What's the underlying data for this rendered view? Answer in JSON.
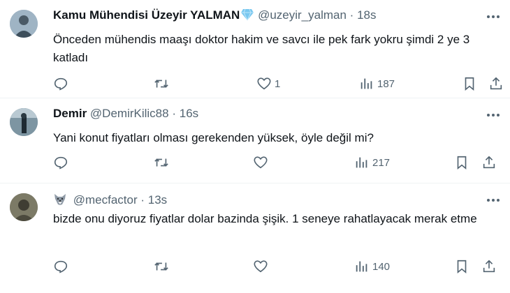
{
  "tweets": [
    {
      "name": "Kamu Mühendisi Üzeyir YALMAN",
      "handle": "@uzeyir_yalman",
      "time": "18s",
      "text": "Önceden mühendis maaşı doktor hakim ve savcı ile pek fark yokru şimdi 2 ye 3 katladı",
      "likes": "1",
      "views": "187",
      "avatar_color": "#8aa3b8"
    },
    {
      "name": "Demir",
      "handle": "@DemirKilic88",
      "time": "16s",
      "text": "Yani konut fiyatları olması gerekenden yüksek, öyle değil mi?",
      "likes": "",
      "views": "217",
      "avatar_color": "#5d7a8c"
    },
    {
      "name": "",
      "handle": "@mecfactor",
      "time": "13s",
      "text": "bizde onu diyoruz fiyatlar dolar bazinda şişik. 1 seneye rahatlayacak merak etme",
      "likes": "",
      "views": "140",
      "avatar_color": "#6b6a58"
    }
  ],
  "colors": {
    "muted": "#536471",
    "verified": "#79c8f0"
  },
  "icons": [
    "reply-icon",
    "retweet-icon",
    "like-icon",
    "views-icon",
    "bookmark-icon",
    "share-icon",
    "more-icon",
    "verified-icon",
    "wolf-emoji-icon"
  ]
}
